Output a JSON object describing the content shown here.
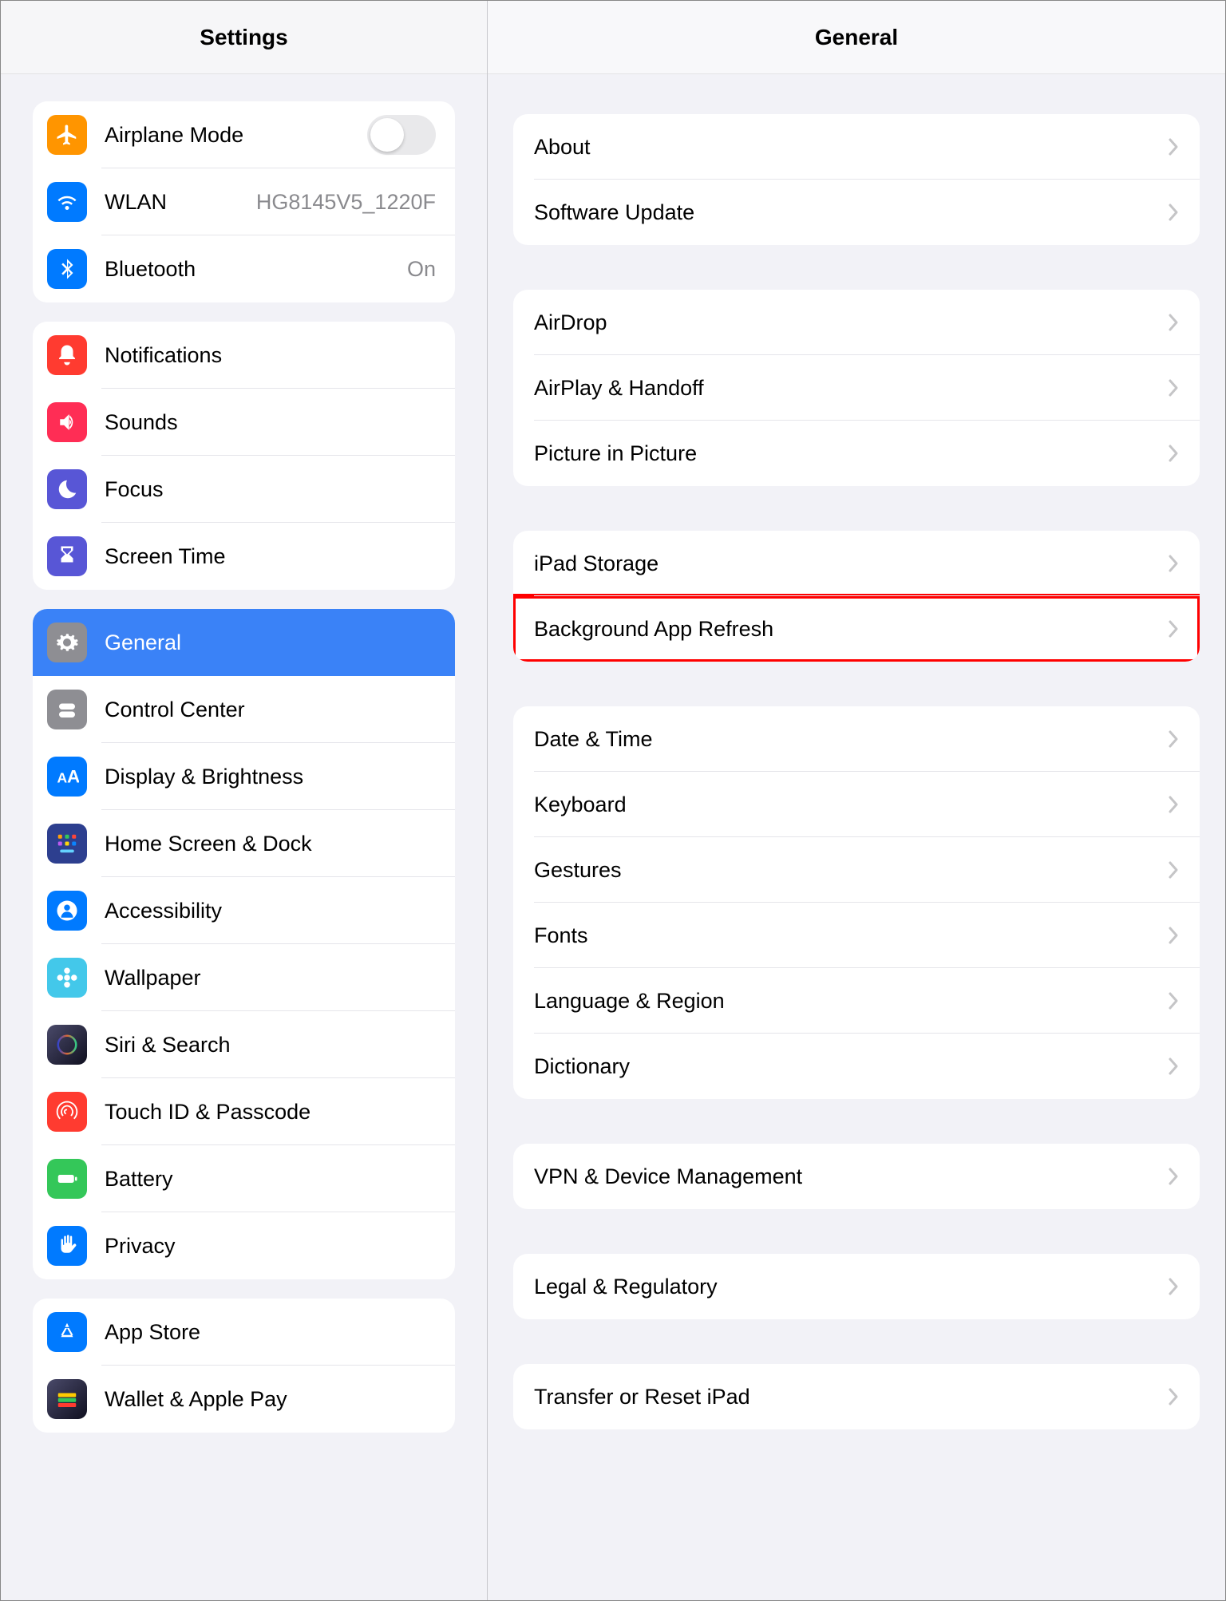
{
  "sidebar": {
    "title": "Settings",
    "groups": [
      {
        "items": [
          {
            "id": "airplane",
            "label": "Airplane Mode",
            "icon": "airplane-icon",
            "bg": "bg-orange",
            "accessory": "toggle"
          },
          {
            "id": "wlan",
            "label": "WLAN",
            "detail": "HG8145V5_1220F",
            "icon": "wifi-icon",
            "bg": "bg-blue",
            "accessory": "detail"
          },
          {
            "id": "bluetooth",
            "label": "Bluetooth",
            "detail": "On",
            "icon": "bluetooth-icon",
            "bg": "bg-blue",
            "accessory": "detail"
          }
        ]
      },
      {
        "items": [
          {
            "id": "notifications",
            "label": "Notifications",
            "icon": "bell-icon",
            "bg": "bg-red"
          },
          {
            "id": "sounds",
            "label": "Sounds",
            "icon": "speaker-icon",
            "bg": "bg-pink"
          },
          {
            "id": "focus",
            "label": "Focus",
            "icon": "moon-icon",
            "bg": "bg-indigo"
          },
          {
            "id": "screentime",
            "label": "Screen Time",
            "icon": "hourglass-icon",
            "bg": "bg-indigo"
          }
        ]
      },
      {
        "items": [
          {
            "id": "general",
            "label": "General",
            "icon": "gear-icon",
            "bg": "bg-gray",
            "selected": true
          },
          {
            "id": "controlcenter",
            "label": "Control Center",
            "icon": "switches-icon",
            "bg": "bg-gray"
          },
          {
            "id": "display",
            "label": "Display & Brightness",
            "icon": "textsize-icon",
            "bg": "bg-blue"
          },
          {
            "id": "homescreen",
            "label": "Home Screen & Dock",
            "icon": "apps-icon",
            "bg": "bg-miniapps"
          },
          {
            "id": "accessibility",
            "label": "Accessibility",
            "icon": "person-icon",
            "bg": "bg-blue"
          },
          {
            "id": "wallpaper",
            "label": "Wallpaper",
            "icon": "flower-icon",
            "bg": "bg-wallpaper"
          },
          {
            "id": "siri",
            "label": "Siri & Search",
            "icon": "siri-icon",
            "bg": "bg-black"
          },
          {
            "id": "touchid",
            "label": "Touch ID & Passcode",
            "icon": "fingerprint-icon",
            "bg": "bg-red"
          },
          {
            "id": "battery",
            "label": "Battery",
            "icon": "battery-icon",
            "bg": "bg-green"
          },
          {
            "id": "privacy",
            "label": "Privacy",
            "icon": "hand-icon",
            "bg": "bg-blue"
          }
        ]
      },
      {
        "items": [
          {
            "id": "appstore",
            "label": "App Store",
            "icon": "appstore-icon",
            "bg": "bg-blue"
          },
          {
            "id": "wallet",
            "label": "Wallet & Apple Pay",
            "icon": "wallet-icon",
            "bg": "bg-black"
          }
        ]
      }
    ]
  },
  "main": {
    "title": "General",
    "groups": [
      {
        "items": [
          {
            "id": "about",
            "label": "About"
          },
          {
            "id": "software-update",
            "label": "Software Update"
          }
        ]
      },
      {
        "items": [
          {
            "id": "airdrop",
            "label": "AirDrop"
          },
          {
            "id": "airplay",
            "label": "AirPlay & Handoff"
          },
          {
            "id": "pip",
            "label": "Picture in Picture"
          }
        ]
      },
      {
        "items": [
          {
            "id": "storage",
            "label": "iPad Storage"
          },
          {
            "id": "bg-refresh",
            "label": "Background App Refresh",
            "highlight": true
          }
        ]
      },
      {
        "items": [
          {
            "id": "datetime",
            "label": "Date & Time"
          },
          {
            "id": "keyboard",
            "label": "Keyboard"
          },
          {
            "id": "gestures",
            "label": "Gestures"
          },
          {
            "id": "fonts",
            "label": "Fonts"
          },
          {
            "id": "language",
            "label": "Language & Region"
          },
          {
            "id": "dictionary",
            "label": "Dictionary"
          }
        ]
      },
      {
        "items": [
          {
            "id": "vpn",
            "label": "VPN & Device Management"
          }
        ]
      },
      {
        "items": [
          {
            "id": "legal",
            "label": "Legal & Regulatory"
          }
        ]
      },
      {
        "items": [
          {
            "id": "transfer",
            "label": "Transfer or Reset iPad"
          }
        ]
      }
    ]
  }
}
